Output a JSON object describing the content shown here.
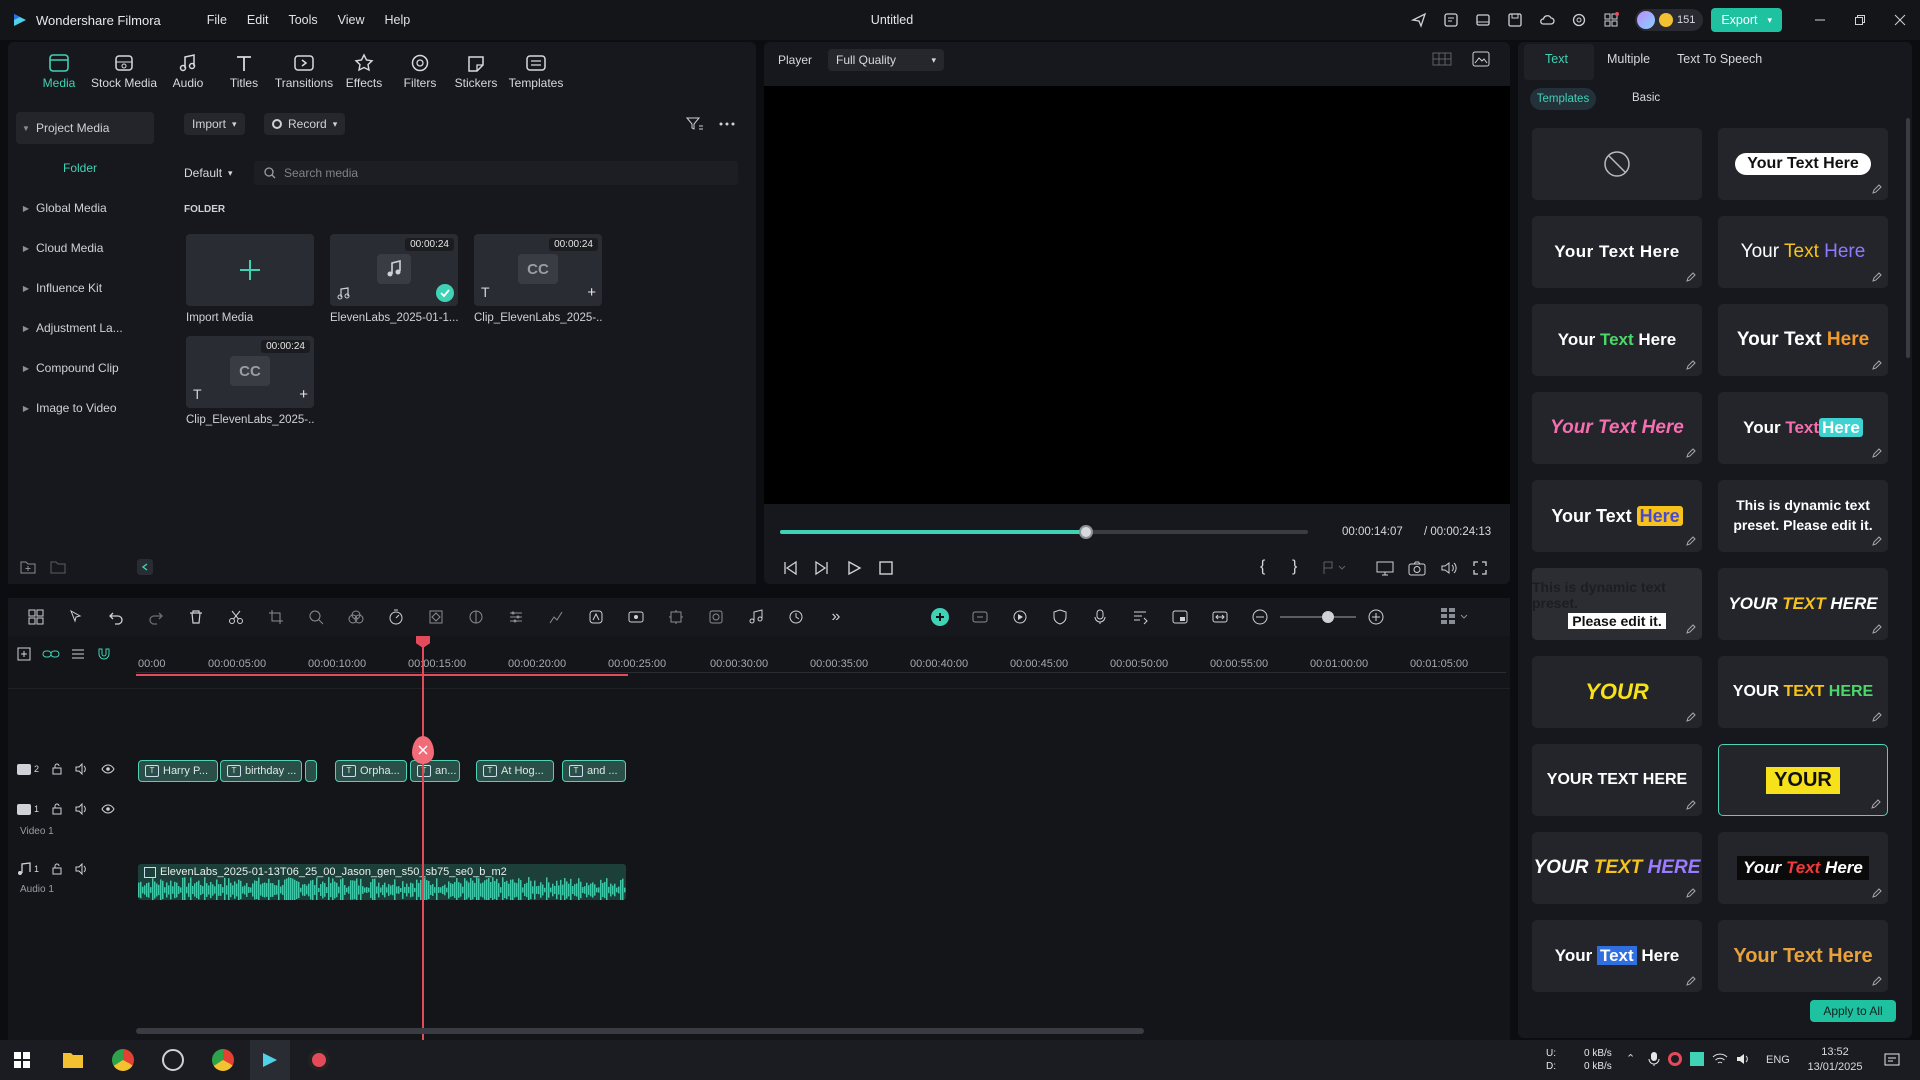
{
  "app": {
    "name": "Wondershare Filmora",
    "doc_title": "Untitled",
    "menus": [
      "File",
      "Edit",
      "Tools",
      "View",
      "Help"
    ],
    "credits": "151",
    "export_label": "Export"
  },
  "media_tabs": [
    {
      "label": "Media",
      "icon": "media-icon"
    },
    {
      "label": "Stock Media",
      "icon": "stock-media-icon"
    },
    {
      "label": "Audio",
      "icon": "audio-icon"
    },
    {
      "label": "Titles",
      "icon": "titles-icon"
    },
    {
      "label": "Transitions",
      "icon": "transitions-icon"
    },
    {
      "label": "Effects",
      "icon": "effects-icon"
    },
    {
      "label": "Filters",
      "icon": "filters-icon"
    },
    {
      "label": "Stickers",
      "icon": "stickers-icon"
    },
    {
      "label": "Templates",
      "icon": "templates-icon"
    }
  ],
  "sidebar": {
    "project_media": "Project Media",
    "folder": "Folder",
    "items": [
      "Global Media",
      "Cloud Media",
      "Influence Kit",
      "Adjustment La...",
      "Compound Clip",
      "Image to Video"
    ]
  },
  "media": {
    "import_label": "Import",
    "record_label": "Record",
    "sort_label": "Default",
    "search_placeholder": "Search media",
    "folder_heading": "FOLDER",
    "import_media_label": "Import Media",
    "items": [
      {
        "name": "ElevenLabs_2025-01-1...",
        "duration": "00:00:24"
      },
      {
        "name": "Clip_ElevenLabs_2025-...",
        "duration": "00:00:24"
      },
      {
        "name": "Clip_ElevenLabs_2025-...",
        "duration": "00:00:24"
      }
    ]
  },
  "player": {
    "label": "Player",
    "quality": "Full Quality",
    "current_time": "00:00:14:07",
    "total_time": "/ 00:00:24:13",
    "progress": 0.58
  },
  "text_panel": {
    "tabs": [
      "Text",
      "Multiple",
      "Text To Speech"
    ],
    "subtabs": [
      "Templates",
      "Basic"
    ],
    "cards": {
      "c1": "Your Text Here",
      "c2": "Your Text Here",
      "c3a": "Your ",
      "c3b": "Text",
      "c3c": " Here",
      "c4a": "Your ",
      "c4b": "Text",
      "c4c": " Here",
      "c5": "Your Text Here",
      "c6a": "Your Text ",
      "c6b": "Here",
      "c7": "Your Text Here",
      "c8a": "Your ",
      "c8b": "Text",
      "c8c": "Here",
      "c9a": "Your Text ",
      "c9b": "Here",
      "c10": "This is dynamic text preset. Please edit it.",
      "c11a": "This is dynamic text preset.",
      "c11b": "Please edit it.",
      "c12a": "YOUR ",
      "c12b": "TEXT",
      "c12c": " HERE",
      "c13": "YOUR",
      "c14a": "YOUR ",
      "c14b": "TEXT",
      "c14c": " HERE",
      "c15": "YOUR TEXT HERE",
      "c16": "YOUR",
      "c17a": "YOUR ",
      "c17b": "TEXT",
      "c17c": " HERE",
      "c18a": "Your ",
      "c18b": "Text",
      "c18c": " Here",
      "c19a": "Your ",
      "c19b": "Text",
      "c19c": " Here",
      "c20": "Your Text Here"
    },
    "apply_label": "Apply to All"
  },
  "timeline": {
    "ticks": [
      "00:00",
      "00:00:05:00",
      "00:00:10:00",
      "00:00:15:00",
      "00:00:20:00",
      "00:00:25:00",
      "00:00:30:00",
      "00:00:35:00",
      "00:00:40:00",
      "00:00:45:00",
      "00:00:50:00",
      "00:00:55:00",
      "00:01:00:00",
      "00:01:05:00"
    ],
    "clips": [
      "Harry P...",
      "birthday ...",
      "Orpha...",
      "an...",
      "At Hog...",
      "and ..."
    ],
    "track2_num": "2",
    "track1_num": "1",
    "video_label": "Video 1",
    "audio_num": "1",
    "audio_label": "Audio 1",
    "audio_clip": "ElevenLabs_2025-01-13T06_25_00_Jason_gen_s50_sb75_se0_b_m2"
  },
  "taskbar": {
    "net_up": "0 kB/s",
    "net_down": "0 kB/s",
    "net_u": "U:",
    "net_d": "D:",
    "lang": "ENG",
    "time": "13:52",
    "date": "13/01/2025"
  }
}
